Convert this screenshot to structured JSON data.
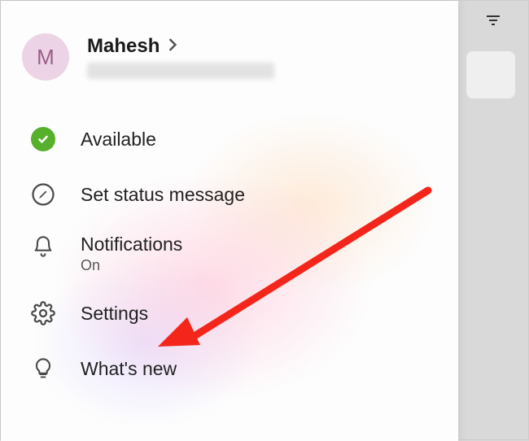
{
  "profile": {
    "avatar_initial": "M",
    "name": "Mahesh"
  },
  "menu": {
    "status_label": "Available",
    "set_status_label": "Set status message",
    "notifications_label": "Notifications",
    "notifications_sub": "On",
    "settings_label": "Settings",
    "whats_new_label": "What's new"
  },
  "colors": {
    "available": "#56b02c",
    "avatar_bg": "#ecd3e5",
    "avatar_fg": "#9a5d8a",
    "annotation": "#f4261b"
  }
}
